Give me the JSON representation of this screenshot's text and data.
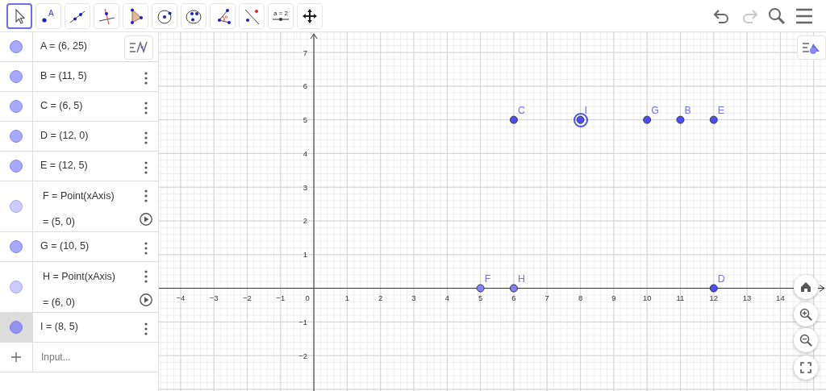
{
  "toolbar": {
    "tools": [
      {
        "kind": "move",
        "selected": true
      },
      {
        "kind": "point",
        "selected": false,
        "label": "A"
      },
      {
        "kind": "line",
        "selected": false
      },
      {
        "kind": "perpendicular",
        "selected": false
      },
      {
        "kind": "polygon",
        "selected": false
      },
      {
        "kind": "circle",
        "selected": false
      },
      {
        "kind": "circle3",
        "selected": false
      },
      {
        "kind": "angle",
        "selected": false
      },
      {
        "kind": "reflect",
        "selected": false
      },
      {
        "kind": "slider",
        "selected": false,
        "label": "a = 2"
      },
      {
        "kind": "pan",
        "selected": false
      }
    ],
    "actions": [
      {
        "kind": "undo",
        "disabled": false
      },
      {
        "kind": "redo",
        "disabled": true
      },
      {
        "kind": "search",
        "disabled": false
      },
      {
        "kind": "menu",
        "disabled": false
      }
    ]
  },
  "algebra": {
    "rows": [
      {
        "kind": "free",
        "text": "A = (6, 25)",
        "selected": false
      },
      {
        "kind": "free",
        "text": "B = (11, 5)",
        "selected": false
      },
      {
        "kind": "free",
        "text": "C = (6, 5)",
        "selected": false
      },
      {
        "kind": "free",
        "text": "D = (12, 0)",
        "selected": false
      },
      {
        "kind": "free",
        "text": "E = (12, 5)",
        "selected": false
      },
      {
        "kind": "dependent",
        "text": "F = Point(xAxis)",
        "value": "= (5, 0)",
        "selected": false
      },
      {
        "kind": "free",
        "text": "G = (10, 5)",
        "selected": false
      },
      {
        "kind": "dependent",
        "text": "H = Point(xAxis)",
        "value": "= (6, 0)",
        "selected": false
      },
      {
        "kind": "free",
        "text": "I = (8, 5)",
        "selected": true
      }
    ],
    "input": {
      "placeholder": "Input..."
    }
  },
  "graphics": {
    "chart_data": {
      "type": "scatter",
      "grid": true,
      "xlim": [
        -4.65,
        15.37
      ],
      "ylim": [
        -3.05,
        7.6
      ],
      "xticks": [
        {
          "value": -4,
          "label": "−4"
        },
        {
          "value": -3,
          "label": "−3"
        },
        {
          "value": -2,
          "label": "−2"
        },
        {
          "value": -1,
          "label": "−1"
        },
        {
          "value": 1,
          "label": "1"
        },
        {
          "value": 2,
          "label": "2"
        },
        {
          "value": 3,
          "label": "3"
        },
        {
          "value": 4,
          "label": "4"
        },
        {
          "value": 5,
          "label": "5"
        },
        {
          "value": 6,
          "label": "6"
        },
        {
          "value": 7,
          "label": "7"
        },
        {
          "value": 8,
          "label": "8"
        },
        {
          "value": 9,
          "label": "9"
        },
        {
          "value": 10,
          "label": "10"
        },
        {
          "value": 11,
          "label": "11"
        },
        {
          "value": 12,
          "label": "12"
        },
        {
          "value": 13,
          "label": "13"
        },
        {
          "value": 14,
          "label": "14"
        }
      ],
      "yticks": [
        {
          "value": -2,
          "label": "−2"
        },
        {
          "value": -1,
          "label": "−1"
        },
        {
          "value": 1,
          "label": "1"
        },
        {
          "value": 2,
          "label": "2"
        },
        {
          "value": 3,
          "label": "3"
        },
        {
          "value": 4,
          "label": "4"
        },
        {
          "value": 5,
          "label": "5"
        },
        {
          "value": 6,
          "label": "6"
        },
        {
          "value": 7,
          "label": "7"
        }
      ],
      "x": [
        6,
        8,
        10,
        11,
        12,
        5,
        6,
        12
      ],
      "series": [
        {
          "color": "#4d4dff",
          "values": [
            5,
            null,
            5,
            5,
            5,
            null,
            null,
            0
          ]
        },
        {
          "color": "#8080ff",
          "values": [
            null,
            null,
            null,
            null,
            null,
            0,
            0,
            null
          ]
        },
        {
          "color": "#4d4dff",
          "values": [
            null,
            5,
            null,
            null,
            null,
            null,
            null,
            null
          ]
        }
      ],
      "annotations": [
        {
          "x": 6,
          "y": 5,
          "text": "C"
        },
        {
          "x": 8,
          "y": 5,
          "text": "I"
        },
        {
          "x": 10,
          "y": 5,
          "text": "G"
        },
        {
          "x": 11,
          "y": 5,
          "text": "B"
        },
        {
          "x": 12,
          "y": 5,
          "text": "E"
        },
        {
          "x": 5,
          "y": 0,
          "text": "F"
        },
        {
          "x": 6,
          "y": 0,
          "text": "H"
        },
        {
          "x": 12,
          "y": 0,
          "text": "D"
        }
      ]
    },
    "origin_label": "0",
    "last_series_selected": true
  }
}
